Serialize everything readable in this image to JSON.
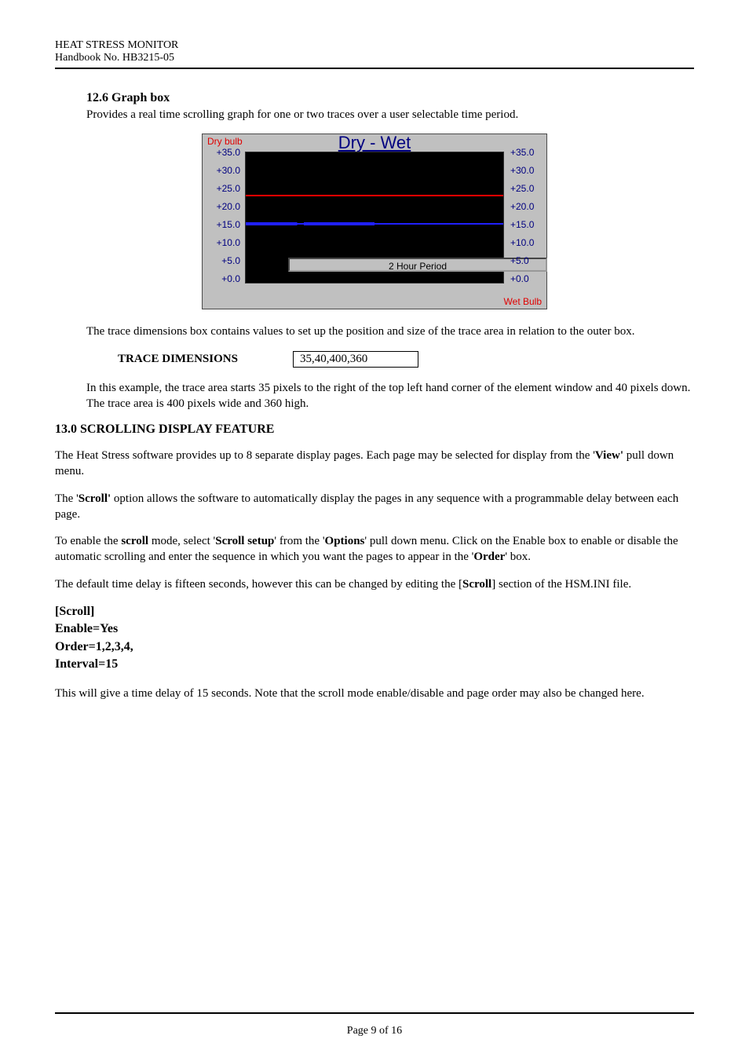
{
  "header": {
    "line1": "HEAT STRESS MONITOR",
    "line2": "Handbook No. HB3215-05"
  },
  "section": {
    "title": "12.6 Graph box",
    "intro": "Provides a real time scrolling graph for one or two traces over a user selectable time period."
  },
  "chart_data": {
    "type": "line",
    "title": "Dry - Wet",
    "top_left_label": "Dry bulb",
    "bottom_right_label": "Wet Bulb",
    "xlabel": "2 Hour Period",
    "ylim": [
      0,
      35
    ],
    "y_ticks_left": [
      "+35.0",
      "+30.0",
      "+25.0",
      "+20.0",
      "+15.0",
      "+10.0",
      "+5.0",
      "+0.0"
    ],
    "y_ticks_right": [
      "+35.0",
      "+30.0",
      "+25.0",
      "+20.0",
      "+15.0",
      "+10.0",
      "+5.0",
      "+0.0"
    ],
    "series": [
      {
        "name": "Dry bulb",
        "approx_value": 27,
        "color": "#ff0000"
      },
      {
        "name": "Wet Bulb",
        "approx_value": 19,
        "color": "#2020ff"
      }
    ]
  },
  "trace_dims": {
    "para1": "The trace dimensions box contains values to set up the position and size of the trace area in relation to the outer box.",
    "label": "TRACE DIMENSIONS",
    "value": "35,40,400,360",
    "para2": "In this example, the trace area starts 35 pixels to the right of the top left hand corner of the element window and 40 pixels down. The trace area is 400 pixels wide and 360 high."
  },
  "scroll": {
    "heading": "13.0 SCROLLING DISPLAY FEATURE",
    "p1a": "The Heat Stress software provides up to 8 separate display pages. Each page may be selected for display from the '",
    "p1b_bold": "View'",
    "p1c": " pull down menu.",
    "p2a": "The '",
    "p2b_bold": "Scroll'",
    "p2c": " option allows the software to automatically display the pages in any sequence with a programmable delay between each page.",
    "p3a": "To enable the ",
    "p3b_bold": "scroll",
    "p3c": " mode, select '",
    "p3d_bold": "Scroll setup",
    "p3e": "' from the '",
    "p3f_bold": "Options",
    "p3g": "' pull down menu. Click on the Enable box to enable or disable the automatic scrolling and enter the sequence in which you want the pages to appear in the '",
    "p3h_bold": "Order",
    "p3i": "' box.",
    "p4a": "The default time delay is fifteen seconds, however this can be changed by editing the [",
    "p4b_bold": "Scroll",
    "p4c": "] section of the HSM.INI file.",
    "cfg1": "[Scroll]",
    "cfg2": "Enable=Yes",
    "cfg3": "Order=1,2,3,4,",
    "cfg4": "Interval=15",
    "p5": "This will give a time delay of 15 seconds. Note that the scroll mode enable/disable and page order may also be changed here."
  },
  "footer": {
    "text": "Page 9 of 16"
  }
}
